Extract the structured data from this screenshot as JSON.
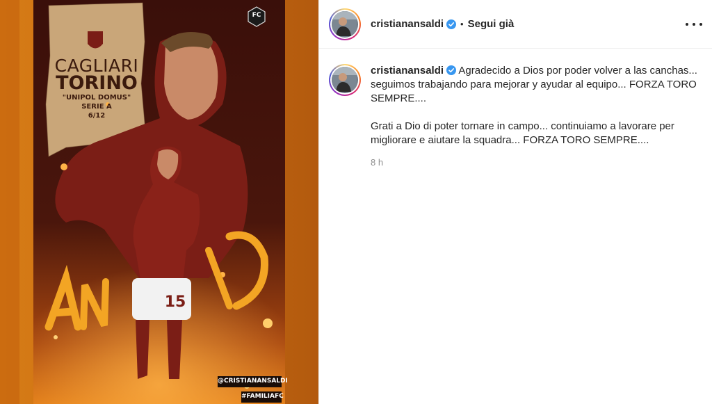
{
  "post": {
    "image": {
      "alt": "Torino football player poster",
      "match_home": "CAGLIARI",
      "match_away": "TORINO",
      "venue": "\"UNIPOL DOMUS\"",
      "league": "SERIE A",
      "date": "6/12",
      "badge": "FC",
      "player_name_art": "ANSALDI",
      "shirt_number": "15",
      "tag_user": "@CRISTIANANSALDI",
      "tag_hashtag": "#FAMILIAFC",
      "colors": {
        "maroon": "#6e1a14",
        "orange": "#e8851d",
        "parchment": "#caa77a"
      }
    },
    "header": {
      "username": "cristianansaldi",
      "verified_icon": "verified-badge-icon",
      "separator": "•",
      "follow_label": "Segui già",
      "more_icon": "more-horizontal-icon"
    },
    "caption": {
      "username": "cristianansaldi",
      "text_es": " Agradecido a Dios por poder volver a las canchas... seguimos trabajando para mejorar y ayudar al equipo... FORZA TORO SEMPRE....",
      "text_it": "Grati a Dio di poter tornare in campo... continuiamo a lavorare per migliorare e aiutare la squadra... FORZA TORO SEMPRE....",
      "time": "8 h"
    },
    "accent_colors": {
      "verified": "#3897f0",
      "muted": "#8e8e8e"
    }
  }
}
